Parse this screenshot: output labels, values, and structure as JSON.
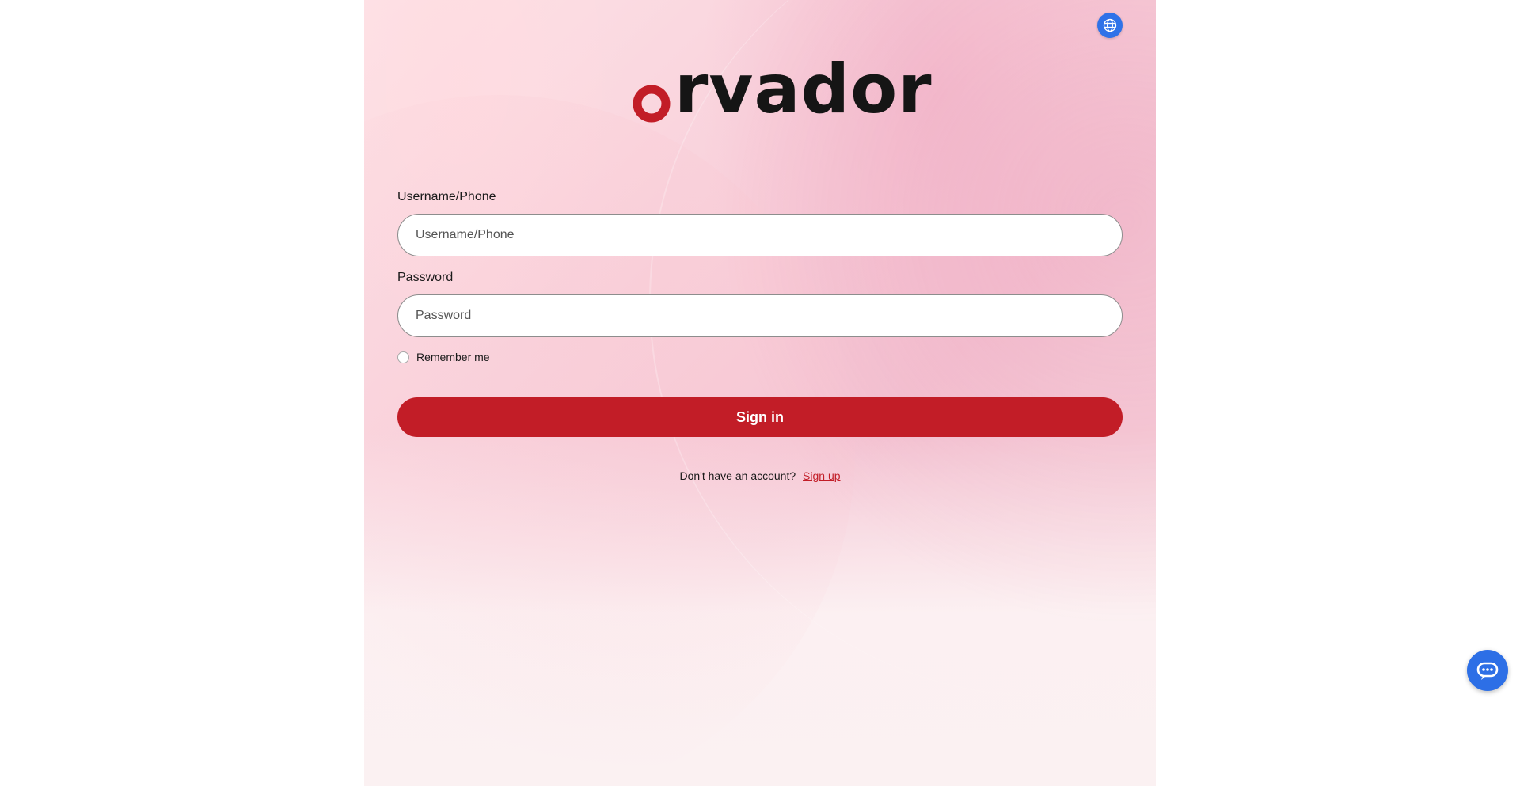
{
  "language_button": {
    "icon": "globe-icon",
    "color": "#2f72e8"
  },
  "brand": {
    "logo_text": "rvador",
    "logo_first_letter": "o",
    "accent_color": "#c21d27"
  },
  "form": {
    "username": {
      "label": "Username/Phone",
      "placeholder": "Username/Phone",
      "value": ""
    },
    "password": {
      "label": "Password",
      "placeholder": "Password",
      "value": ""
    },
    "remember_me": {
      "label": "Remember me",
      "checked": false
    },
    "submit_label": "Sign in"
  },
  "signup": {
    "prompt": "Don't have an account?",
    "link_label": "Sign up"
  },
  "chat_button": {
    "icon": "chat-bubble-icon",
    "color": "#2d6fe6"
  }
}
